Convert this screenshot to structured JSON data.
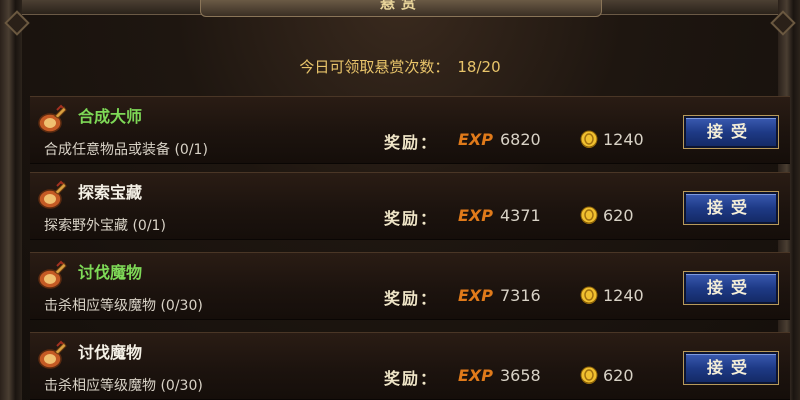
{
  "window": {
    "title": "悬赏"
  },
  "counter": {
    "label": "今日可领取悬赏次数：",
    "value": "18/20"
  },
  "reward_label": "奖励：",
  "exp_tag": "EXP",
  "accept_label": "接受",
  "colors": {
    "quest_name_green": "#7ed957",
    "quest_name_white": "#f4f0e6",
    "exp_orange": "#e07a1a",
    "accept_button_blue": "#1e3a86"
  },
  "icons": {
    "quest": "scroll-icon",
    "gold": "gold-coin-icon"
  },
  "quests": [
    {
      "name": "合成大师",
      "name_color": "green",
      "description": "合成任意物品或装备 (0/1)",
      "exp": "6820",
      "gold": "1240"
    },
    {
      "name": "探索宝藏",
      "name_color": "white",
      "description": "探索野外宝藏 (0/1)",
      "exp": "4371",
      "gold": "620"
    },
    {
      "name": "讨伐魔物",
      "name_color": "green",
      "description": "击杀相应等级魔物 (0/30)",
      "exp": "7316",
      "gold": "1240"
    },
    {
      "name": "讨伐魔物",
      "name_color": "white",
      "description": "击杀相应等级魔物 (0/30)",
      "exp": "3658",
      "gold": "620"
    }
  ]
}
